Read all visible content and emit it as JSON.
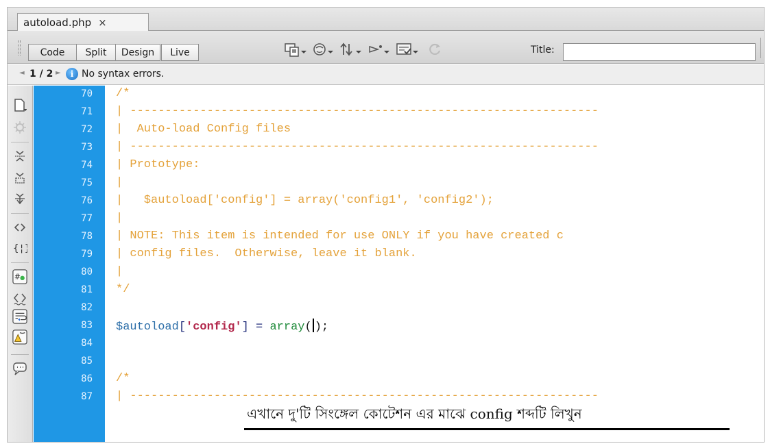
{
  "tab": {
    "filename": "autoload.php",
    "close": "×"
  },
  "toolbar": {
    "code_label": "Code",
    "split_label": "Split",
    "design_label": "Design",
    "live_label": "Live",
    "title_label": "Title:",
    "title_value": "",
    "icons": [
      "multiscreen-icon",
      "browser-preview-icon",
      "file-management-icon",
      "visual-aids-icon",
      "check-page-icon",
      "refresh-icon"
    ]
  },
  "status": {
    "page": "1 / 2",
    "message": "No syntax errors.",
    "info_glyph": "i"
  },
  "left_tools": [
    "open-documents-icon",
    "show-code-navigator-icon",
    "collapse-full-tag-icon",
    "collapse-selection-icon",
    "expand-all-icon",
    "select-parent-tag-icon",
    "balance-braces-icon",
    "line-numbers-icon",
    "highlight-invalid-code-icon",
    "word-wrap-icon",
    "syntax-coloring-icon",
    "apply-comment-icon"
  ],
  "gutter": {
    "lines": [
      "70",
      "71",
      "72",
      "73",
      "74",
      "75",
      "76",
      "77",
      "78",
      "79",
      "80",
      "81",
      "82",
      "83",
      "84",
      "85",
      "86",
      "87"
    ]
  },
  "code": {
    "l70": "/*",
    "l71": "| -------------------------------------------------------------------",
    "l72": "|  Auto-load Config files",
    "l73": "| -------------------------------------------------------------------",
    "l74": "| Prototype:",
    "l75": "|",
    "l76": "|   $autoload['config'] = array('config1', 'config2');",
    "l77": "|",
    "l78": "| NOTE: This item is intended for use ONLY if you have created c",
    "l79": "| config files.  Otherwise, leave it blank.",
    "l80": "|",
    "l81": "*/",
    "l83_var": "$autoload",
    "l83_open": "[",
    "l83_key": "'config'",
    "l83_close": "]",
    "l83_eq": " = ",
    "l83_fn": "array",
    "l83_lp": "(",
    "l83_rp": ")",
    "l83_semi": ";",
    "l86": "/*",
    "l87": "| -------------------------------------------------------------------"
  },
  "annotation": "এখানে দু'টি সিংঙ্গেল কোটেশন এর মাঝে config শব্দটি লিখুন",
  "colors": {
    "gutter": "#1f97e5",
    "comment": "#e4a23a",
    "variable": "#2c6ea8",
    "string": "#b2284c",
    "function": "#1f8a3a"
  }
}
